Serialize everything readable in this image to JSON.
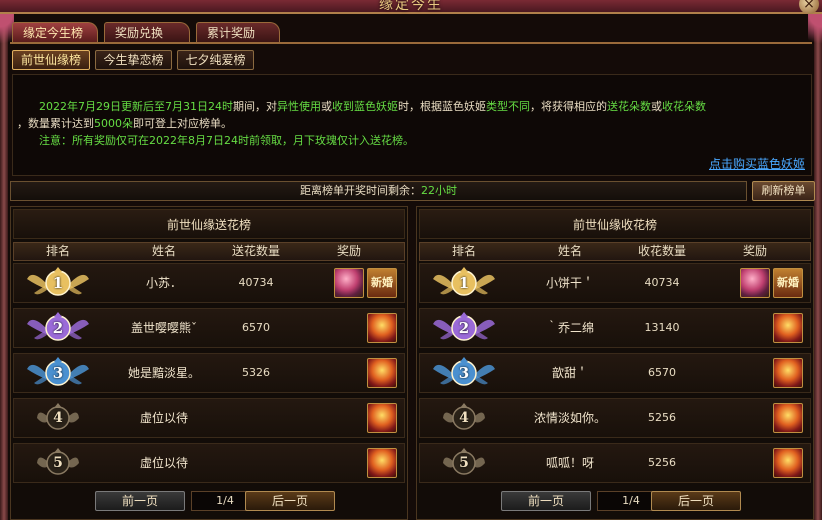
{
  "window": {
    "title": "缘定今生",
    "close_label": "×"
  },
  "main_tabs": [
    {
      "label": "缘定今生榜",
      "active": true
    },
    {
      "label": "奖励兑换",
      "active": false
    },
    {
      "label": "累计奖励",
      "active": false
    }
  ],
  "sub_tabs": [
    {
      "label": "前世仙缘榜",
      "active": true
    },
    {
      "label": "今生挚恋榜",
      "active": false
    },
    {
      "label": "七夕纯爱榜",
      "active": false
    }
  ],
  "notice": {
    "l1": {
      "a": "2022年7月29日更新后至7月31日24时",
      "b": "期间，对",
      "c": "异性使用",
      "d": "或",
      "e": "收到蓝色妖姬",
      "f": "时，根据蓝色妖姬",
      "g": "类型不同",
      "h": "，将获得相应的",
      "i": "送花朵数",
      "j": "或",
      "k": "收花朵数"
    },
    "l2": {
      "a": "，数量累计达到",
      "b": "5000朵",
      "c": "即可登上对应榜单。"
    },
    "l3": {
      "a": "注意：所有奖励仅可在2022年8月7日24时前领取，月下玫瑰仅计入送花榜。"
    },
    "buy_link": "点击购买蓝色妖姬"
  },
  "countdown": {
    "label": "距离榜单开奖时间剩余：",
    "value": "22小时"
  },
  "refresh_label": "刷新榜单",
  "columns": {
    "rank": "排名",
    "name": "姓名",
    "reward": "奖励"
  },
  "left": {
    "title": "前世仙缘送花榜",
    "count_header": "送花数量",
    "rows": [
      {
        "rank": "1",
        "name": "小苏．",
        "count": "40734"
      },
      {
        "rank": "2",
        "name": "盖世嘤嘤熊ˇ",
        "count": "6570"
      },
      {
        "rank": "3",
        "name": "她是黯淡星。",
        "count": "5326"
      },
      {
        "rank": "4",
        "name": "虚位以待",
        "count": ""
      },
      {
        "rank": "5",
        "name": "虚位以待",
        "count": ""
      }
    ]
  },
  "right": {
    "title": "前世仙缘收花榜",
    "count_header": "收花数量",
    "rows": [
      {
        "rank": "1",
        "name": "小饼干＇",
        "count": "40734"
      },
      {
        "rank": "2",
        "name": "｀乔二绵",
        "count": "13140"
      },
      {
        "rank": "3",
        "name": "歆甜＇",
        "count": "6570"
      },
      {
        "rank": "4",
        "name": "浓情淡如你。",
        "count": "5256"
      },
      {
        "rank": "5",
        "name": "呱呱！呀",
        "count": "5256"
      }
    ]
  },
  "reward_title_text": "新婚",
  "pager": {
    "prev": "前一页",
    "page": "1/4",
    "next": "后一页"
  },
  "colors": {
    "gold": "#e8c060",
    "purple": "#9a6ad8",
    "blue": "#4a90d0",
    "bronze": "#8a7a62",
    "highlight": "#66dd44"
  }
}
